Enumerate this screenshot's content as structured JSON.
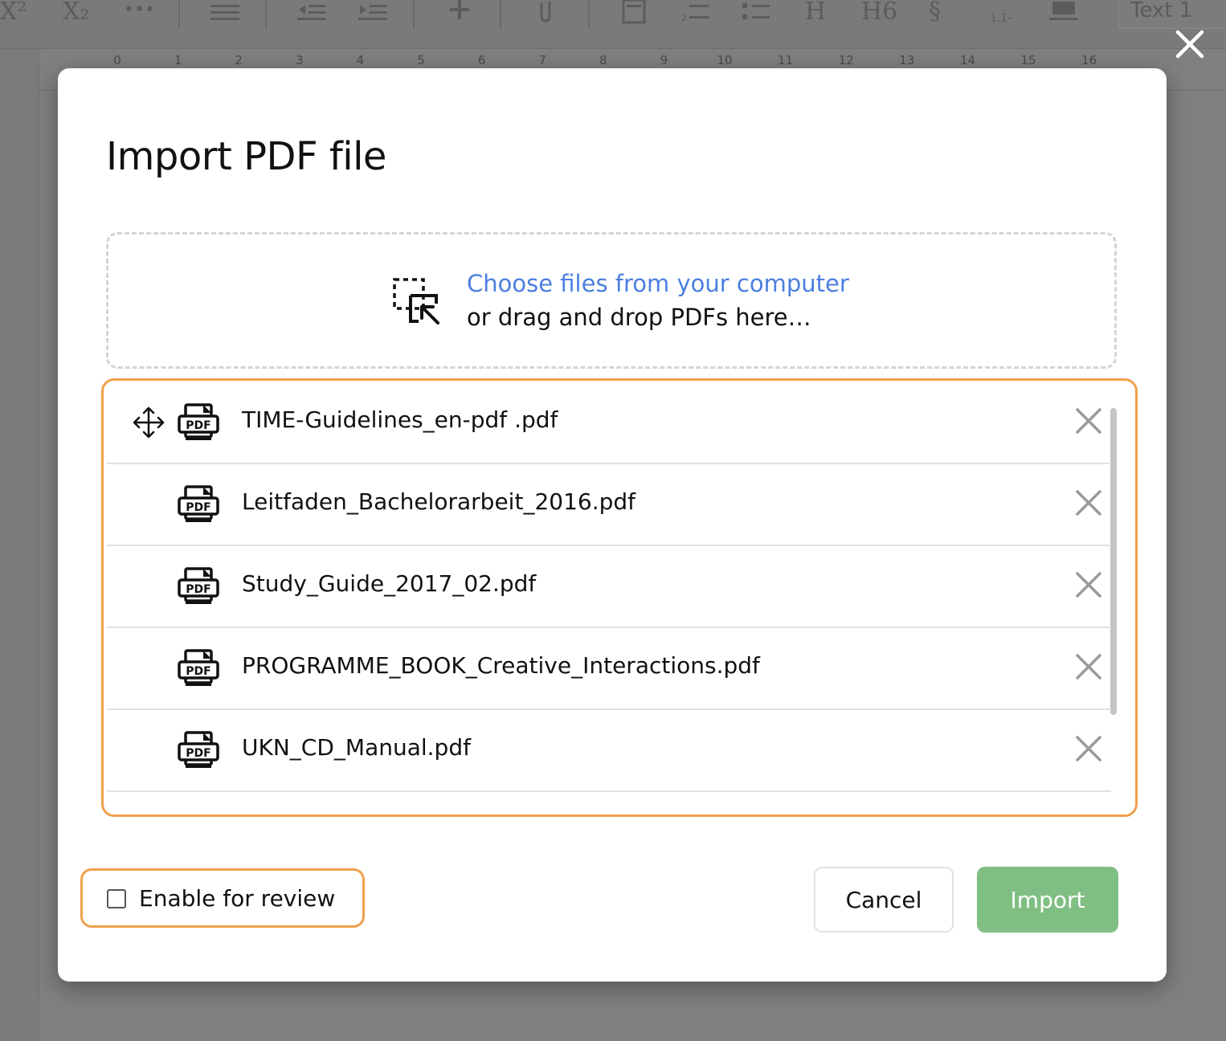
{
  "toolbar": {
    "superscript_label": "X²",
    "subscript_label": "X₂",
    "more_label": "•••",
    "heading_label": "H",
    "heading6_label": "H6",
    "section_label": "§",
    "numbering_label": "1.1–",
    "style_select": "Text 1"
  },
  "ruler": {
    "numbers": [
      "0",
      "1",
      "2",
      "3",
      "4",
      "5",
      "6",
      "7",
      "8",
      "9",
      "10",
      "11",
      "12",
      "13",
      "14",
      "15",
      "16"
    ]
  },
  "dialog": {
    "title": "Import PDF file",
    "dropzone": {
      "link_text": "Choose files from your computer",
      "sub_text": "or drag and drop PDFs here…",
      "icon": "select-file-icon"
    },
    "files": [
      {
        "name": "TIME-Guidelines_en-pdf .pdf",
        "icon": "pdf-icon",
        "show_drag_handle": true
      },
      {
        "name": "Leitfaden_Bachelorarbeit_2016.pdf",
        "icon": "pdf-icon",
        "show_drag_handle": false
      },
      {
        "name": "Study_Guide_2017_02.pdf",
        "icon": "pdf-icon",
        "show_drag_handle": false
      },
      {
        "name": "PROGRAMME_BOOK_Creative_Interactions.pdf",
        "icon": "pdf-icon",
        "show_drag_handle": false
      },
      {
        "name": "UKN_CD_Manual.pdf",
        "icon": "pdf-icon",
        "show_drag_handle": false
      }
    ],
    "review_checkbox": {
      "label": "Enable for review",
      "checked": false
    },
    "cancel_label": "Cancel",
    "import_label": "Import"
  },
  "colors": {
    "link": "#4b7fe0",
    "highlight_border": "#f0a04b",
    "import_button": "#80bf83",
    "overlay": "#7b7b7b"
  }
}
